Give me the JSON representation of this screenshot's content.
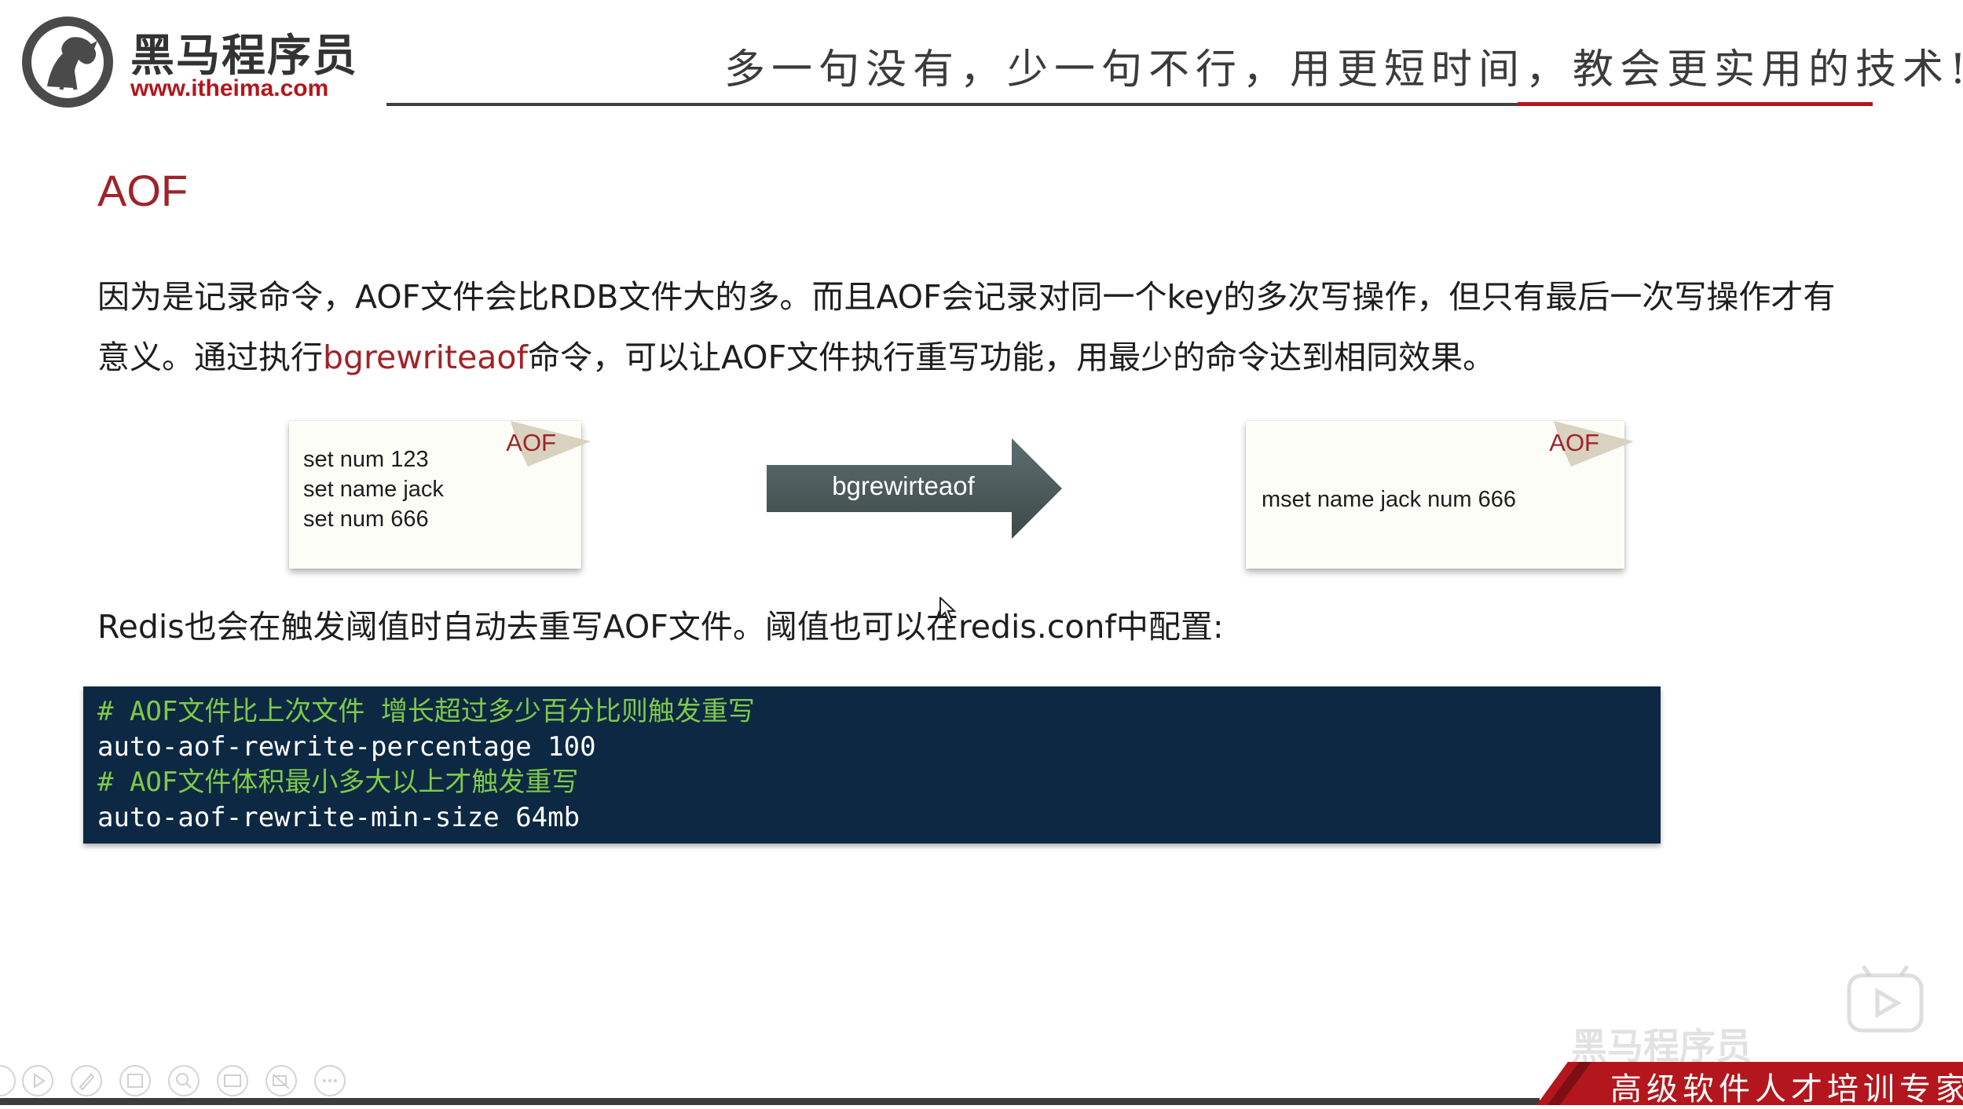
{
  "header": {
    "logo_cn": "黑马程序员",
    "logo_url": "www.itheima.com",
    "slogan": "多一句没有，少一句不行，用更短时间，教会更实用的技术!"
  },
  "slide": {
    "title": "AOF",
    "para1_pre": "因为是记录命令，AOF文件会比RDB文件大的多。而且AOF会记录对同一个key的多次写操作，但只有最后一次写操作才有意义。通过执行",
    "para1_highlight": "bgrewriteaof",
    "para1_post": "命令，可以让AOF文件执行重写功能，用最少的命令达到相同效果。",
    "left_note": {
      "label": "AOF",
      "lines": [
        "set num 123",
        "set name jack",
        "set num 666"
      ]
    },
    "arrow_label": "bgrewirteaof",
    "right_note": {
      "label": "AOF",
      "text": "mset name jack num 666"
    },
    "para2": "Redis也会在触发阈值时自动去重写AOF文件。阈值也可以在redis.conf中配置:",
    "code": {
      "comment1": "# AOF文件比上次文件 增长超过多少百分比则触发重写",
      "line1": "auto-aof-rewrite-percentage 100",
      "comment2": "# AOF文件体积最小多大以上才触发重写",
      "line2": "auto-aof-rewrite-min-size 64mb"
    }
  },
  "footer": {
    "watermark_cn": "黑马程序员",
    "banner": "高级软件人才培训专家",
    "toolbar_icons": [
      "play-icon",
      "pen-icon",
      "slides-icon",
      "zoom-icon",
      "subtitles-icon",
      "camera-off-icon",
      "more-icon"
    ]
  },
  "colors": {
    "accent_red": "#a0232a",
    "code_bg": "#0c2843",
    "code_comment": "#7fc94a",
    "arrow": "#4a5a5a"
  }
}
